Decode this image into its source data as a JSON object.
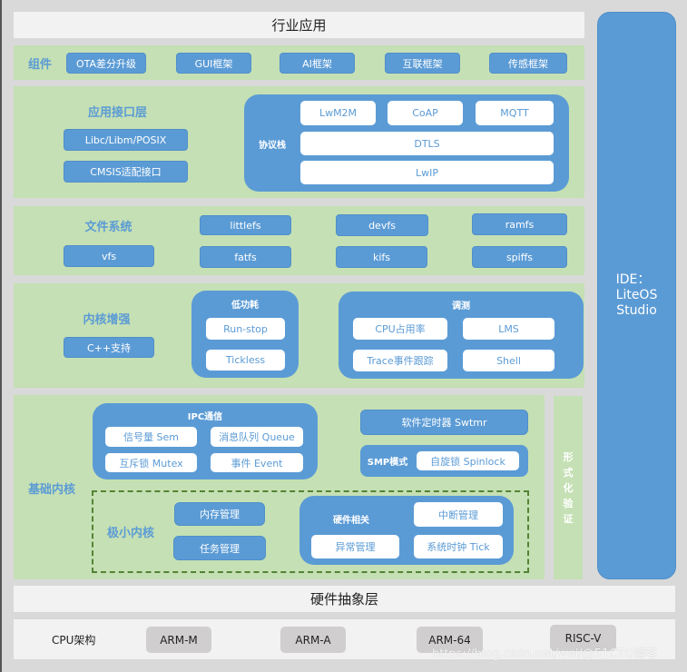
{
  "industry_app": {
    "title": "行业应用"
  },
  "components": {
    "label": "组件",
    "items": [
      "OTA差分升级",
      "GUI框架",
      "AI框架",
      "互联框架",
      "传感框架"
    ]
  },
  "app_interface": {
    "label": "应用接口层",
    "items": [
      "Libc/Libm/POSIX",
      "CMSIS适配接口"
    ],
    "protocol_stack": {
      "label": "协议栈",
      "top_row": [
        "LwM2M",
        "CoAP",
        "MQTT"
      ],
      "middle": "DTLS",
      "bottom": "LwIP"
    }
  },
  "file_system": {
    "label": "文件系统",
    "row1": [
      "littlefs",
      "devfs",
      "ramfs"
    ],
    "row2": [
      "vfs",
      "fatfs",
      "kifs",
      "spiffs"
    ]
  },
  "kernel_enhance": {
    "label": "内核增强",
    "cpp": "C++支持",
    "low_power": {
      "label": "低功耗",
      "items": [
        "Run-stop",
        "Tickless"
      ]
    },
    "debug": {
      "label": "调测",
      "items": [
        "CPU占用率",
        "LMS",
        "Trace事件跟踪",
        "Shell"
      ]
    }
  },
  "base_kernel": {
    "label": "基础内核",
    "ipc": {
      "label": "IPC通信",
      "items": [
        "信号量 Sem",
        "消息队列 Queue",
        "互斥锁 Mutex",
        "事件 Event"
      ]
    },
    "swtmr": "软件定时器 Swtmr",
    "smp": {
      "label": "SMP模式",
      "item": "自旋锁 Spinlock"
    },
    "mini_kernel": {
      "label": "极小内核",
      "items": [
        "内存管理",
        "任务管理"
      ],
      "hardware": {
        "label": "硬件相关",
        "items": [
          "中断管理",
          "异常管理",
          "系统时钟 Tick"
        ]
      }
    }
  },
  "formal_verification": {
    "chars": [
      "形",
      "式",
      "化",
      "验",
      "证"
    ]
  },
  "ide": {
    "lines": [
      "IDE：",
      "LiteOS",
      "Studio"
    ]
  },
  "hal": {
    "title": "硬件抽象层"
  },
  "cpu_arch": {
    "label": "CPU架构",
    "items": [
      "ARM-M",
      "ARM-A",
      "ARM-64",
      "RISC-V"
    ]
  },
  "watermark": "https://blog.csdn.net/wei/@51CTO博客",
  "colors": {
    "background": "#d9d9d9",
    "light_band": "#f2f2f2",
    "green_band": "#c5e0b4",
    "accent_blue": "#5b9bd5",
    "dashed_border": "#548235",
    "cpu_button": "#d0cece"
  }
}
